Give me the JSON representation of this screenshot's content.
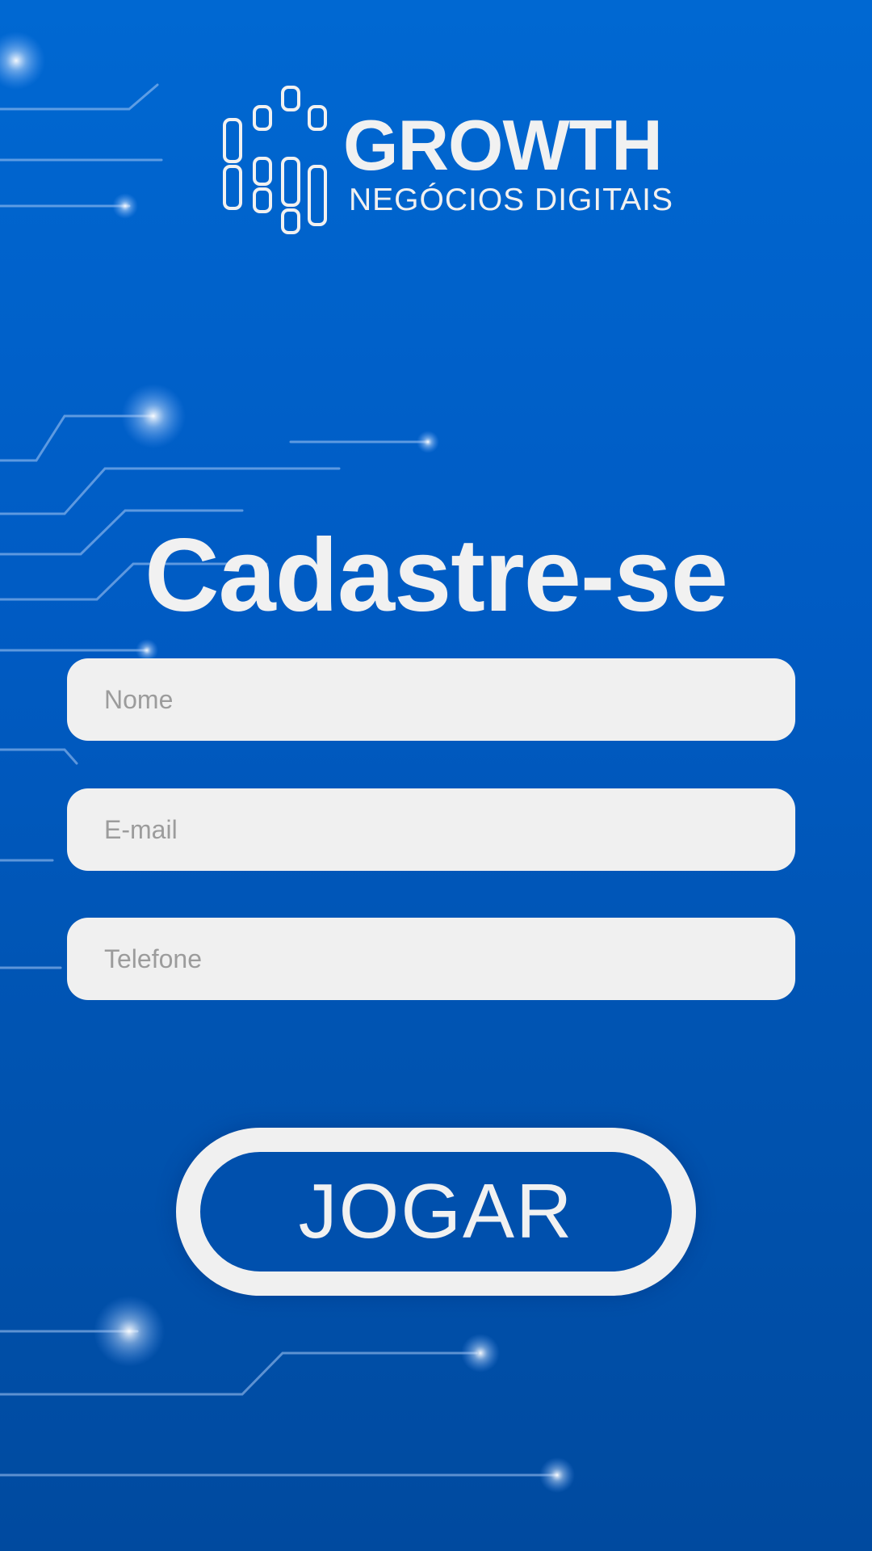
{
  "brand": {
    "name": "GROWTH",
    "tagline": "NEGÓCIOS DIGITAIS"
  },
  "title": "Cadastre-se",
  "form": {
    "name_placeholder": "Nome",
    "email_placeholder": "E-mail",
    "phone_placeholder": "Telefone"
  },
  "play_button": {
    "label": "JOGAR"
  },
  "colors": {
    "background_top": "#0068d2",
    "background_bottom": "#004a9f",
    "field_background": "#f0f0f0",
    "placeholder_text": "#9c9c9c",
    "button_fill": "#0050ad",
    "text_light": "#f1f1f1"
  }
}
